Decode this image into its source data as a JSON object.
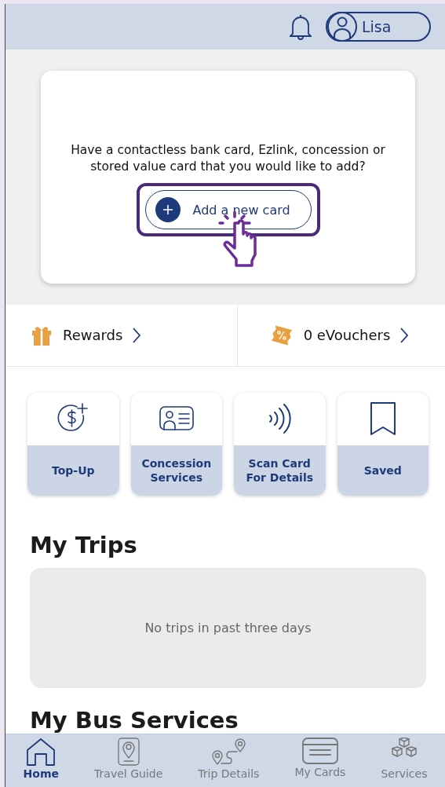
{
  "header": {
    "user_name": "Lisa"
  },
  "add_card": {
    "prompt": "Have a contactless bank card, Ezlink, concession or stored value card that you would like to add?",
    "button": "Add a new card"
  },
  "links": [
    {
      "kind": "rewards",
      "label": "Rewards"
    },
    {
      "kind": "vouchers",
      "label": "0 eVouchers"
    }
  ],
  "tiles": [
    {
      "kind": "topup",
      "label": "Top-Up"
    },
    {
      "kind": "concession",
      "label": "Concession Services"
    },
    {
      "kind": "scan",
      "label": "Scan Card For Details"
    },
    {
      "kind": "saved",
      "label": "Saved"
    }
  ],
  "trips": {
    "title": "My Trips",
    "empty": "No trips in past three days"
  },
  "bus_services": {
    "title": "My Bus Services"
  },
  "nav": [
    {
      "kind": "home",
      "label": "Home",
      "selected": true
    },
    {
      "kind": "guide",
      "label": "Travel Guide",
      "selected": false
    },
    {
      "kind": "trip",
      "label": "Trip Details",
      "selected": false
    },
    {
      "kind": "cards",
      "label": "My Cards",
      "selected": false
    },
    {
      "kind": "services",
      "label": "Services",
      "selected": false
    }
  ]
}
